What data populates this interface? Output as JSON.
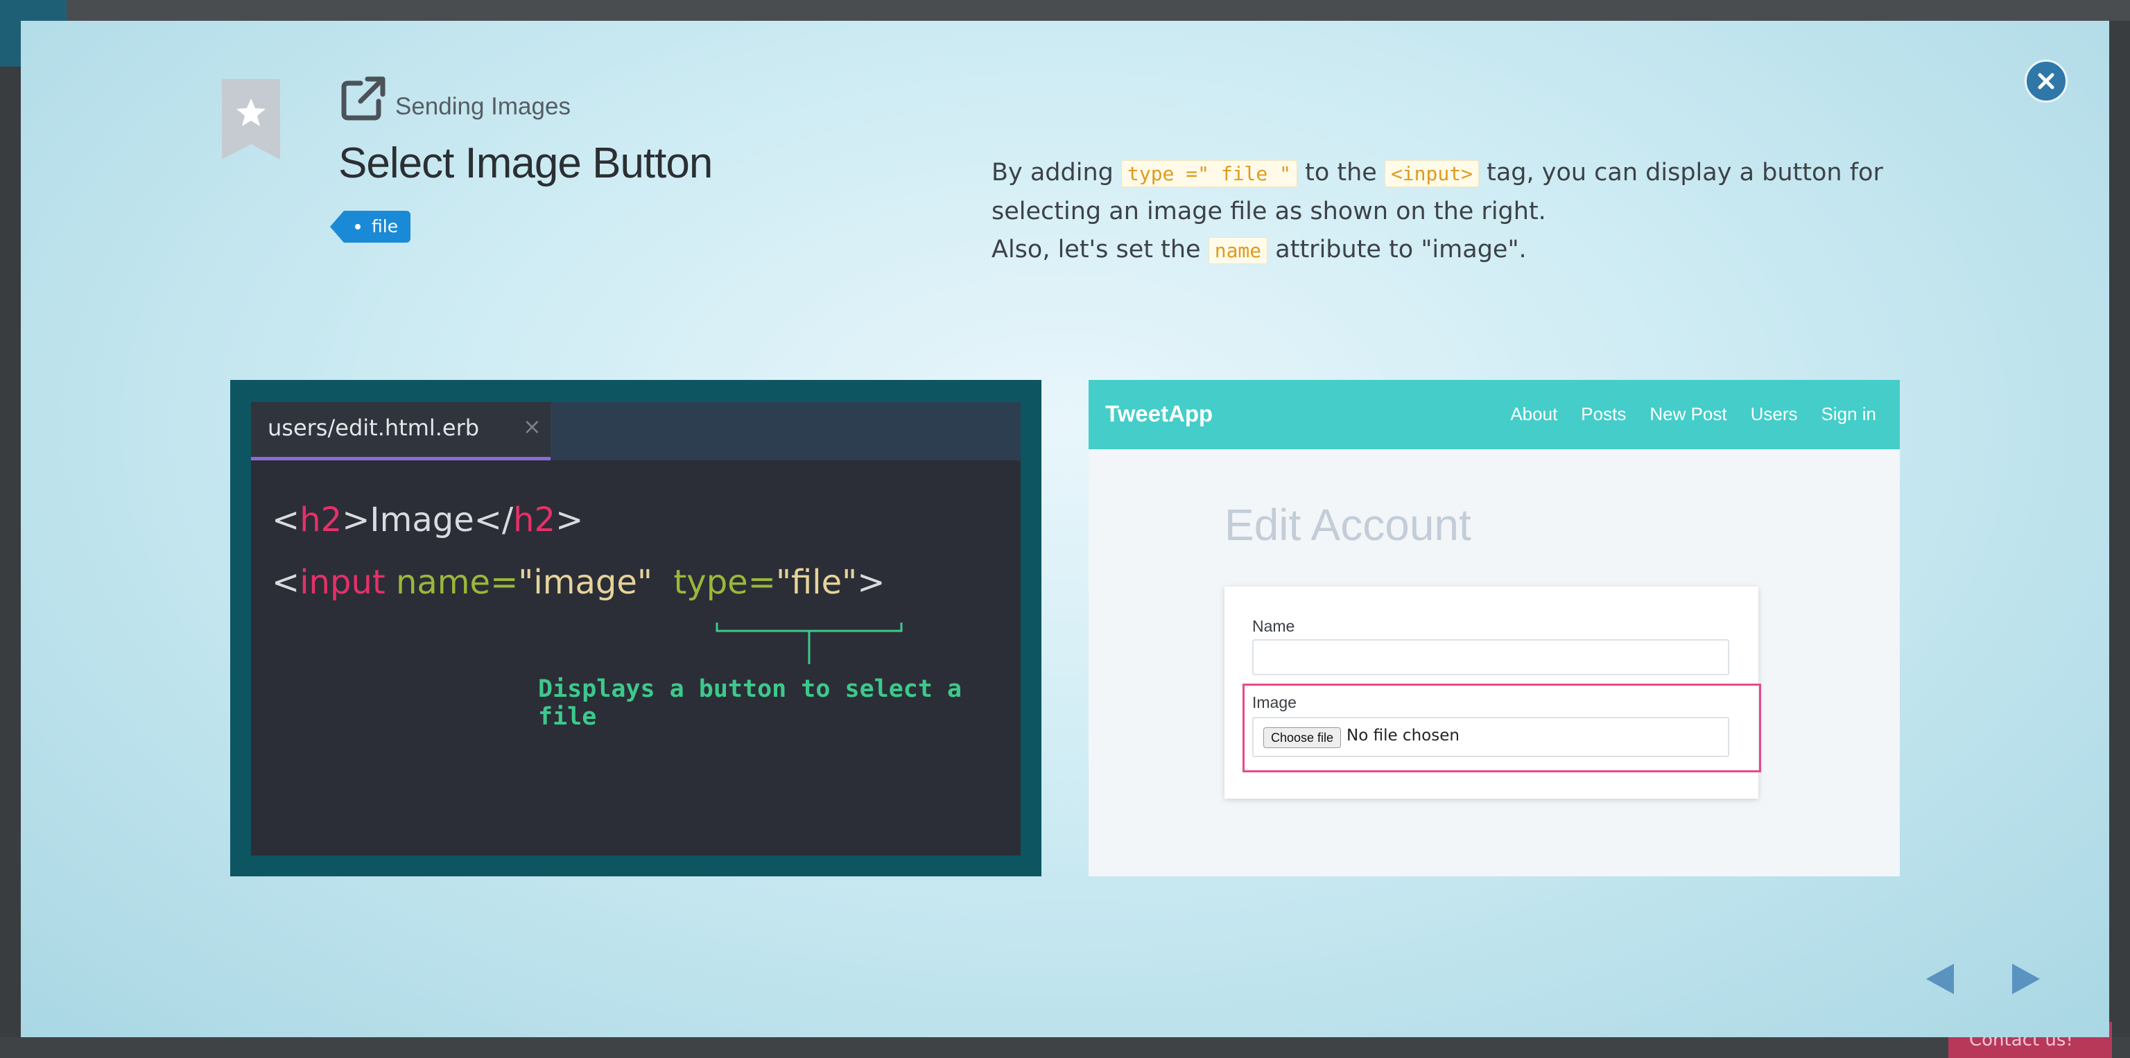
{
  "modal": {
    "chapter": "Sending Images",
    "title": "Select Image Button",
    "tag": "file"
  },
  "description": {
    "p1_a": "By adding ",
    "p1_code1": "type =\" file \"",
    "p1_b": " to the ",
    "p1_code2": "<input>",
    "p1_c": " tag, you can display a button for selecting an image file as shown on the right.",
    "p2_a": "Also, let's set the ",
    "p2_code": "name",
    "p2_b": " attribute to \"image\"."
  },
  "code_panel": {
    "tab": "users/edit.html.erb",
    "tab_close": "×",
    "annotation": "Displays a button to select a file"
  },
  "preview": {
    "brand": "TweetApp",
    "nav": [
      "About",
      "Posts",
      "New Post",
      "Users",
      "Sign in"
    ],
    "heading": "Edit Account",
    "name_label": "Name",
    "image_label": "Image",
    "choose_file": "Choose file",
    "no_file": "No file chosen"
  },
  "background": {
    "contact": "Contact us!"
  },
  "colors": {
    "close_button": "#2f77a8",
    "tag": "#1a8ad6",
    "code_tag": "#e6306a",
    "code_attr": "#9ab83a",
    "annotation": "#3dc98c",
    "nav_bg": "#44cdc9",
    "highlight": "#e8488a"
  },
  "icons": [
    "bookmark-star-icon",
    "external-link-icon",
    "close-icon",
    "prev-arrow-icon",
    "next-arrow-icon"
  ]
}
